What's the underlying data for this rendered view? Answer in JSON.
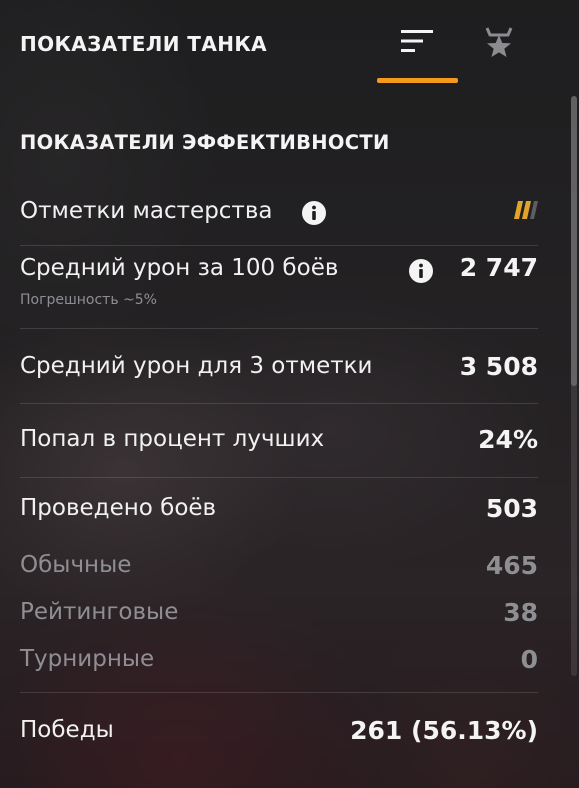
{
  "header": {
    "title": "ПОКАЗАТЕЛИ ТАНКА",
    "tabs": [
      {
        "id": "stats",
        "icon": "list-icon",
        "active": true
      },
      {
        "id": "marks",
        "icon": "star-icon",
        "active": false
      }
    ],
    "accent_color": "#f39a1f"
  },
  "section": {
    "title": "ПОКАЗАТЕЛИ ЭФФЕКТИВНОСТИ"
  },
  "rows": {
    "mastery": {
      "label": "Отметки мастерства",
      "icon": "mastery-marks-icon",
      "icon_color": "#e0a52a"
    },
    "avg_damage_100": {
      "label": "Средний урон за 100 боёв",
      "value": "2 747",
      "sub": "Погрешность ~5%"
    },
    "avg_damage_3marks": {
      "label": "Средний урон для 3 отметки",
      "value": "3 508"
    },
    "top_percent": {
      "label": "Попал в процент лучших",
      "value": "24%"
    },
    "battles": {
      "label": "Проведено боёв",
      "value": "503"
    },
    "regular": {
      "label": "Обычные",
      "value": "465"
    },
    "rating": {
      "label": "Рейтинговые",
      "value": "38"
    },
    "tournament": {
      "label": "Турнирные",
      "value": "0"
    },
    "wins": {
      "label": "Победы",
      "value": "261 (56.13%)"
    }
  }
}
